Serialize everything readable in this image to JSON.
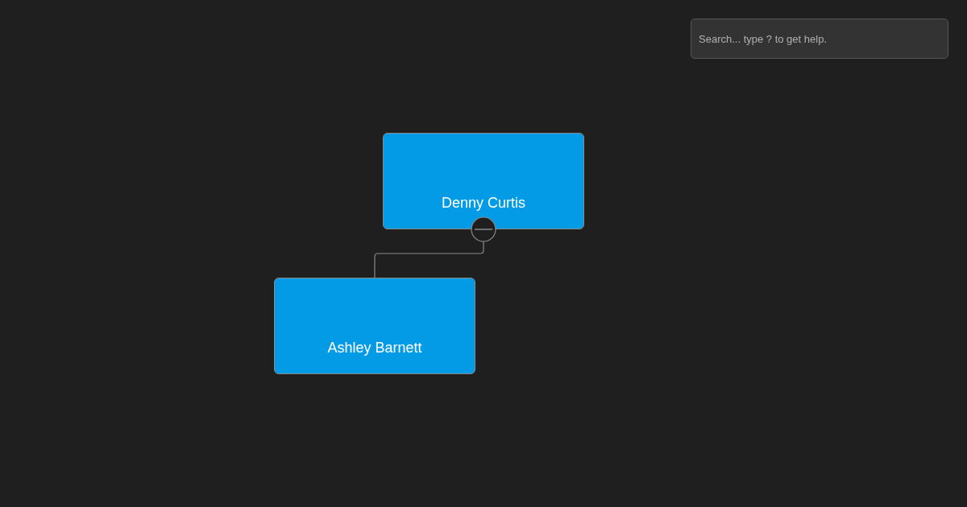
{
  "search": {
    "placeholder": "Search... type ? to get help."
  },
  "org_chart": {
    "root": {
      "name": "Denny Curtis",
      "expanded": true,
      "children": [
        {
          "name": "Ashley Barnett"
        }
      ]
    }
  }
}
